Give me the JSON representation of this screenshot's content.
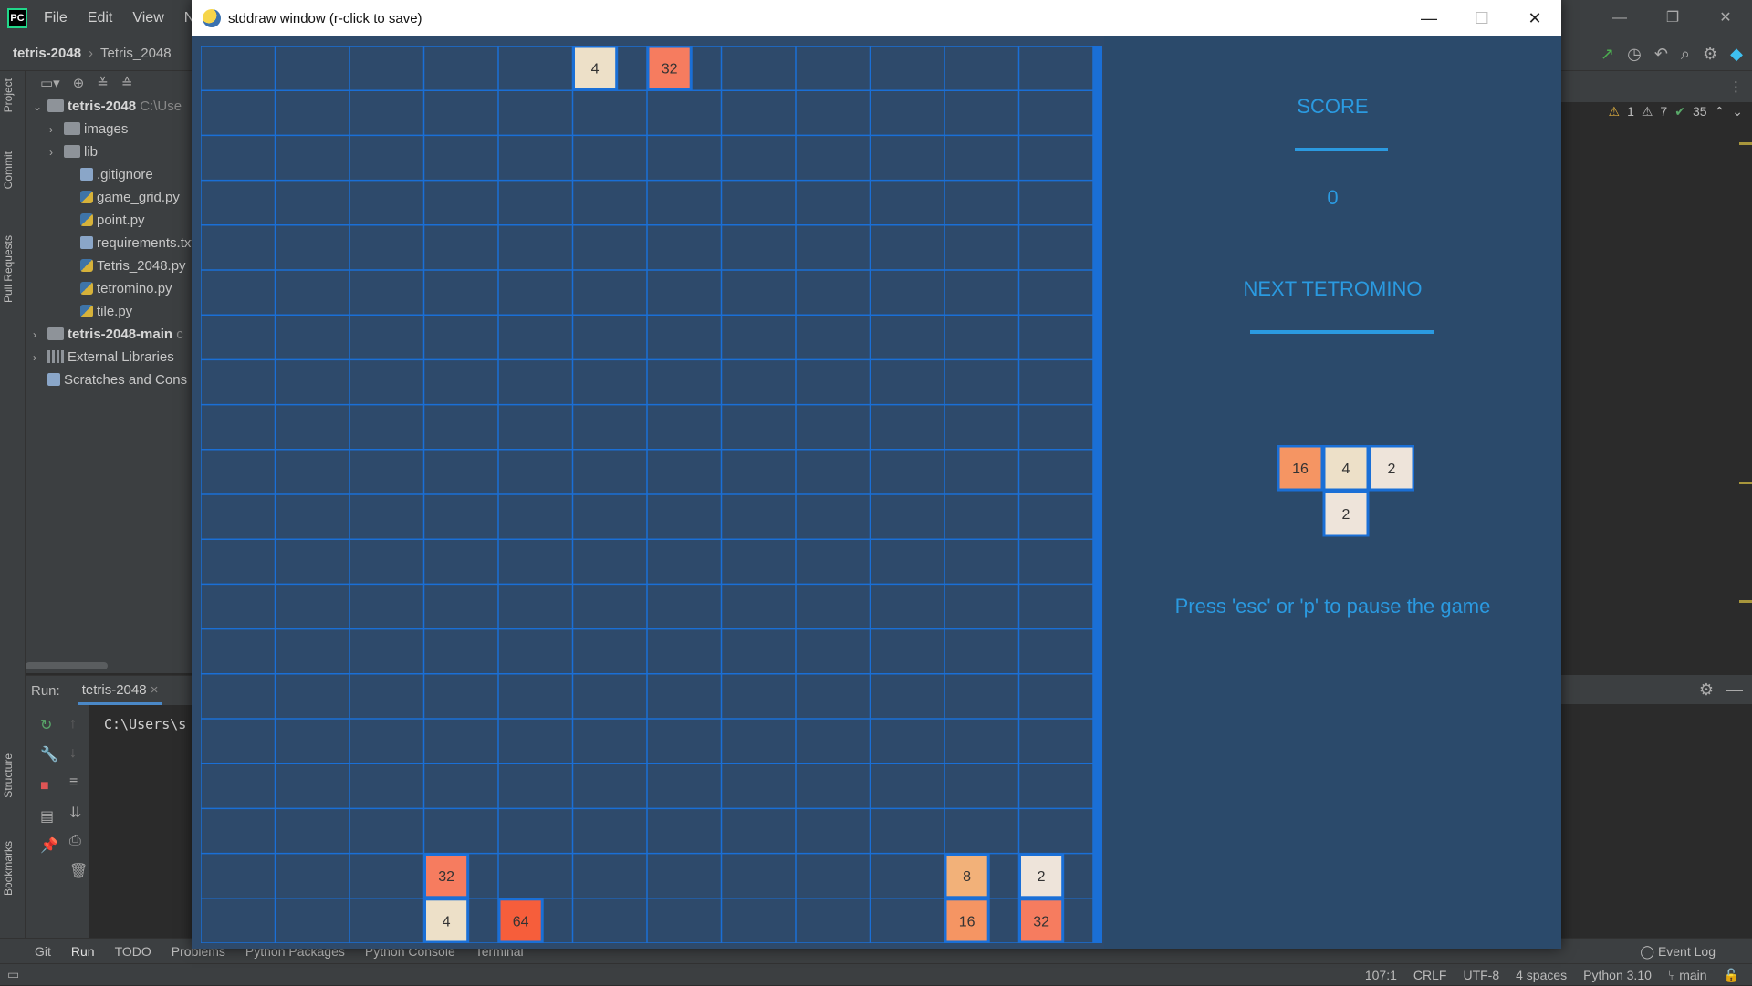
{
  "ide": {
    "menu": [
      "File",
      "Edit",
      "View",
      "Navig"
    ],
    "breadcrumb": {
      "project": "tetris-2048",
      "file": "Tetris_2048"
    },
    "window_controls": {
      "minimize": "—",
      "restore": "❐",
      "close": "✕"
    },
    "side_tabs": [
      "Project",
      "Commit",
      "Pull Requests",
      "Structure",
      "Bookmarks"
    ],
    "tree": [
      {
        "label": "tetris-2048",
        "suffix": "C:\\Use",
        "level": 0,
        "type": "folder",
        "expanded": true,
        "bold": true
      },
      {
        "label": "images",
        "level": 1,
        "type": "folder",
        "expanded": false
      },
      {
        "label": "lib",
        "level": 1,
        "type": "folder",
        "expanded": false
      },
      {
        "label": ".gitignore",
        "level": 2,
        "type": "txt"
      },
      {
        "label": "game_grid.py",
        "level": 2,
        "type": "py"
      },
      {
        "label": "point.py",
        "level": 2,
        "type": "py"
      },
      {
        "label": "requirements.txt",
        "level": 2,
        "type": "txt"
      },
      {
        "label": "Tetris_2048.py",
        "level": 2,
        "type": "py"
      },
      {
        "label": "tetromino.py",
        "level": 2,
        "type": "py"
      },
      {
        "label": "tile.py",
        "level": 2,
        "type": "py"
      },
      {
        "label": "tetris-2048-main",
        "suffix": "c",
        "level": 0,
        "type": "folder",
        "expanded": false,
        "bold": true
      },
      {
        "label": "External Libraries",
        "level": 0,
        "type": "lib",
        "expanded": false
      },
      {
        "label": "Scratches and Cons",
        "level": 0,
        "type": "scratch"
      }
    ],
    "run": {
      "label": "Run:",
      "tab": "tetris-2048",
      "console_line": "C:\\Users\\s"
    },
    "inspections": {
      "warnings": "1",
      "weak_warnings": "7",
      "ok": "35"
    },
    "bottom_tabs": [
      "Git",
      "Run",
      "TODO",
      "Problems",
      "Python Packages",
      "Python Console",
      "Terminal"
    ],
    "event_log": "Event Log",
    "status": {
      "position": "107:1",
      "line_sep": "CRLF",
      "encoding": "UTF-8",
      "indent": "4 spaces",
      "interpreter": "Python 3.10",
      "branch": "main"
    }
  },
  "stddraw": {
    "title": "stddraw window (r-click to save)",
    "controls": {
      "minimize": "—",
      "maximize": "☐",
      "close": "✕"
    },
    "grid": {
      "cols": 12,
      "rows": 20,
      "line_color": "#1a6fd6",
      "bg_color": "#2e4a6b",
      "tiles": [
        {
          "col": 5,
          "row": 0,
          "value": 4
        },
        {
          "col": 6,
          "row": 0,
          "value": 32
        },
        {
          "col": 3,
          "row": 18,
          "value": 32
        },
        {
          "col": 3,
          "row": 19,
          "value": 4
        },
        {
          "col": 4,
          "row": 19,
          "value": 64
        },
        {
          "col": 10,
          "row": 18,
          "value": 8
        },
        {
          "col": 11,
          "row": 18,
          "value": 2
        },
        {
          "col": 10,
          "row": 19,
          "value": 16
        },
        {
          "col": 11,
          "row": 19,
          "value": 32
        }
      ]
    },
    "panel": {
      "score_label": "SCORE",
      "score": "0",
      "next_label": "NEXT TETROMINO",
      "next_tiles": [
        {
          "col": 0,
          "row": 0,
          "value": 16
        },
        {
          "col": 1,
          "row": 0,
          "value": 4
        },
        {
          "col": 2,
          "row": 0,
          "value": 2
        },
        {
          "col": 1,
          "row": 1,
          "value": 2
        }
      ],
      "pause_hint": "Press 'esc' or 'p' to pause the game",
      "text_color": "#2b9ae0"
    },
    "tile_colors": {
      "2": "#eee4da",
      "4": "#ede0c8",
      "8": "#f2b179",
      "16": "#f59563",
      "32": "#f67c5f",
      "64": "#f65e3b"
    }
  }
}
